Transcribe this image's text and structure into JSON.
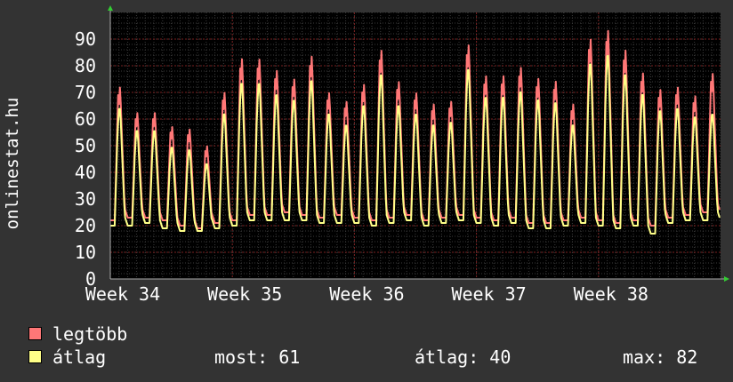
{
  "chart_data": {
    "type": "line",
    "ylabel": "onlinestat.hu",
    "ylim": [
      0,
      100
    ],
    "yticks": [
      0,
      10,
      20,
      30,
      40,
      50,
      60,
      70,
      80,
      90
    ],
    "x_range_days": [
      0,
      35
    ],
    "xticks": [
      {
        "label": "Week 34",
        "day": 0
      },
      {
        "label": "Week 35",
        "day": 7
      },
      {
        "label": "Week 36",
        "day": 14
      },
      {
        "label": "Week 37",
        "day": 21
      },
      {
        "label": "Week 38",
        "day": 28
      }
    ],
    "series": [
      {
        "name": "legtöbb",
        "color": "#ff7777",
        "daily_min": [
          22,
          23,
          23,
          22,
          20,
          19,
          21,
          22,
          24,
          24,
          25,
          24,
          23,
          24,
          23,
          22,
          23,
          24,
          22,
          23,
          24,
          23,
          22,
          23,
          21,
          21,
          22,
          23,
          22,
          21,
          22,
          20,
          23,
          24,
          25
        ],
        "daily_max": [
          69,
          60,
          60,
          55,
          54,
          48,
          67,
          79,
          79,
          75,
          72,
          80,
          67,
          64,
          70,
          82,
          71,
          67,
          63,
          64,
          84,
          73,
          73,
          76,
          72,
          71,
          63,
          86,
          89,
          82,
          74,
          68,
          69,
          66,
          74
        ]
      },
      {
        "name": "átlag",
        "color": "#ffff88",
        "daily_min": [
          20,
          20,
          21,
          19,
          18,
          18,
          19,
          20,
          22,
          22,
          22,
          22,
          21,
          21,
          21,
          20,
          21,
          22,
          20,
          21,
          22,
          21,
          20,
          21,
          19,
          19,
          20,
          21,
          20,
          19,
          20,
          17,
          21,
          22,
          22
        ],
        "daily_max": [
          62,
          54,
          54,
          48,
          47,
          42,
          60,
          71,
          71,
          67,
          65,
          72,
          60,
          56,
          63,
          74,
          63,
          60,
          56,
          57,
          76,
          66,
          66,
          68,
          65,
          64,
          56,
          78,
          81,
          74,
          67,
          61,
          62,
          59,
          60
        ]
      }
    ],
    "grid": true
  },
  "legend": {
    "series1_label": "legtöbb",
    "series2_label": "átlag",
    "series1_color": "#ff7777",
    "series2_color": "#ffff88"
  },
  "stats": {
    "most": "most: 61",
    "atlag": "átlag: 40",
    "max": "max: 82"
  }
}
